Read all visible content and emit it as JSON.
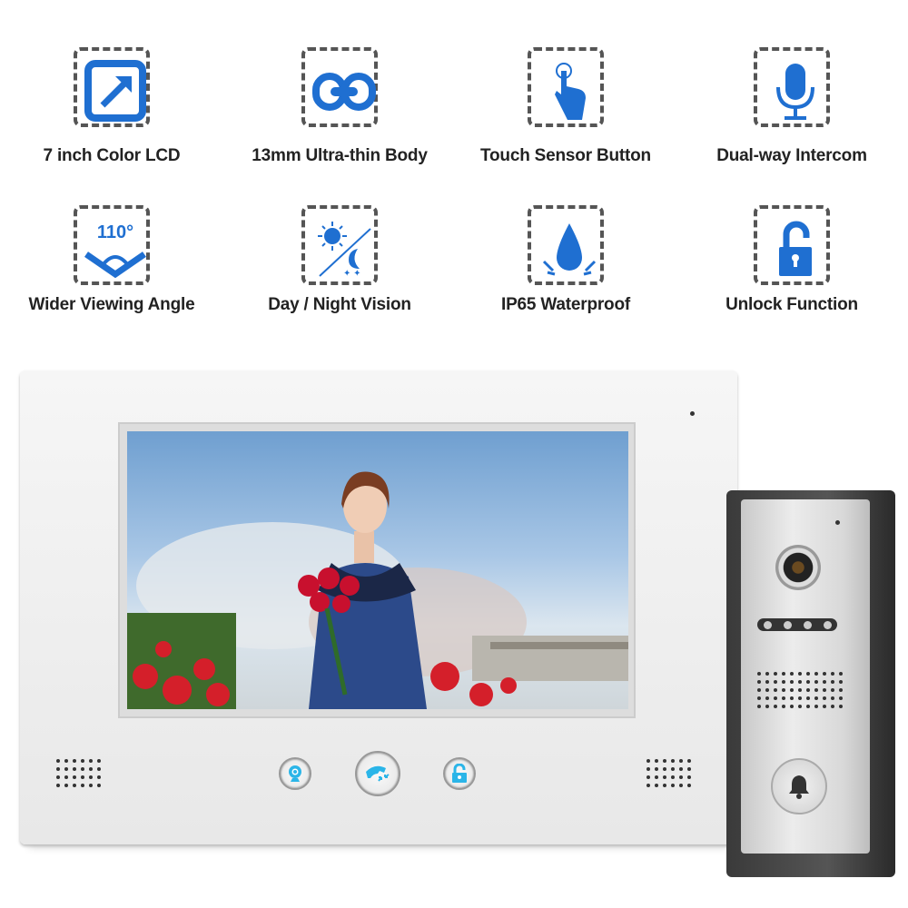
{
  "features": [
    {
      "label": "7 inch Color LCD",
      "icon": "resize-arrow-icon"
    },
    {
      "label": "13mm Ultra-thin Body",
      "icon": "link-icon"
    },
    {
      "label": "Touch Sensor  Button",
      "icon": "touch-hand-icon"
    },
    {
      "label": "Dual-way Intercom",
      "icon": "microphone-icon"
    },
    {
      "label": "Wider Viewing Angle",
      "icon": "viewing-angle-icon",
      "badge": "110°"
    },
    {
      "label": "Day / Night Vision",
      "icon": "day-night-icon"
    },
    {
      "label": "IP65 Waterproof",
      "icon": "water-drop-icon"
    },
    {
      "label": "Unlock Function",
      "icon": "unlock-icon"
    }
  ],
  "colors": {
    "accent": "#1f6fd1",
    "button_icon": "#2bb5e8",
    "frame": "#555555"
  },
  "monitor": {
    "buttons": [
      {
        "icon": "webcam-icon"
      },
      {
        "icon": "phone-call-icon"
      },
      {
        "icon": "unlock-icon"
      }
    ]
  },
  "doorbell": {
    "button_icon": "bell-icon"
  }
}
